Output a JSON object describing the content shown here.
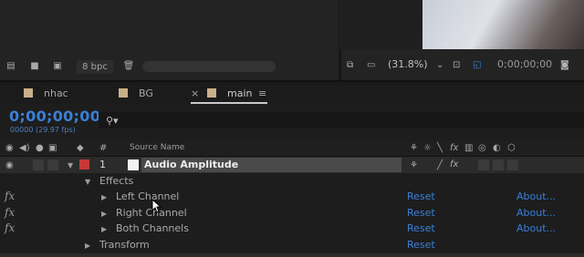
{
  "project": {
    "bpc_label": "8 bpc"
  },
  "viewer": {
    "zoom": "(31.8%)",
    "timecode": "0;00;00;00"
  },
  "tabs": [
    {
      "label": "nhac"
    },
    {
      "label": "BG"
    },
    {
      "label": "main",
      "close": "×",
      "menu": "≡"
    }
  ],
  "timeline": {
    "timecode": "0;00;00;00",
    "fps": "00000 (29.97 fps)",
    "search_placeholder": ""
  },
  "columns": {
    "number": "#",
    "source_name": "Source Name"
  },
  "layer": {
    "number": "1",
    "name": "Audio Amplitude"
  },
  "effects_group": "Effects",
  "effects": [
    {
      "name": "Left Channel",
      "reset": "Reset",
      "about": "About..."
    },
    {
      "name": "Right Channel",
      "reset": "Reset",
      "about": "About..."
    },
    {
      "name": "Both Channels",
      "reset": "Reset",
      "about": "About..."
    }
  ],
  "transform": {
    "name": "Transform",
    "reset": "Reset"
  },
  "fx_label": "fx",
  "colors": {
    "accent": "#3a7fd6",
    "label_red": "#c73838",
    "label_tan": "#c9b08a"
  }
}
